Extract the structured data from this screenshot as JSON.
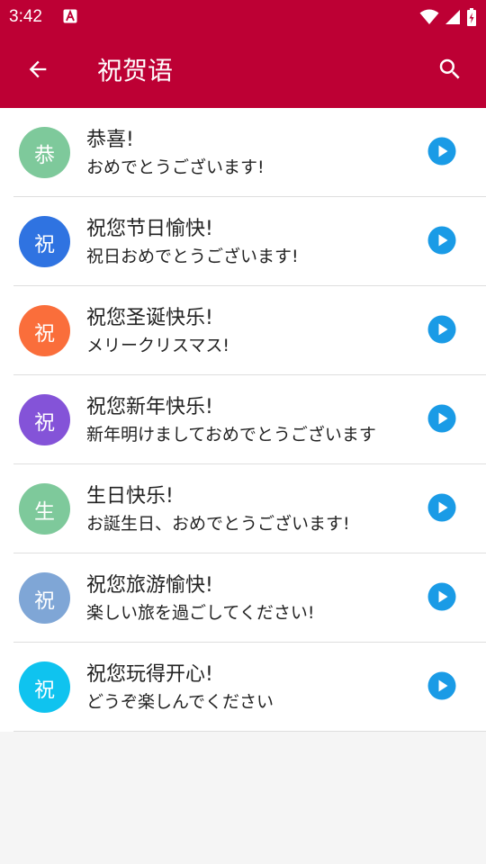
{
  "status_bar": {
    "time": "3:42",
    "notification_icon": "a-notification-icon",
    "icons": [
      "wifi-icon",
      "cell-signal-icon",
      "battery-icon"
    ]
  },
  "app_bar": {
    "title": "祝贺语",
    "back_icon": "arrow-left-icon",
    "search_icon": "search-icon"
  },
  "colors": {
    "primary": "#bd0034",
    "play_button": "#1a9be6",
    "background": "#f5f5f5"
  },
  "items": [
    {
      "avatar": "恭",
      "avatar_color": "#7ec99b",
      "title": "恭喜!",
      "subtitle": "おめでとうございます!"
    },
    {
      "avatar": "祝",
      "avatar_color": "#2f73e1",
      "title": "祝您节日愉快!",
      "subtitle": "祝日おめでとうございます!"
    },
    {
      "avatar": "祝",
      "avatar_color": "#fa6e3b",
      "title": "祝您圣诞快乐!",
      "subtitle": "メリークリスマス!"
    },
    {
      "avatar": "祝",
      "avatar_color": "#8453d8",
      "title": "祝您新年快乐!",
      "subtitle": "新年明けましておめでとうございます"
    },
    {
      "avatar": "生",
      "avatar_color": "#7ec99b",
      "title": "生日快乐!",
      "subtitle": "お誕生日、おめでとうございます!"
    },
    {
      "avatar": "祝",
      "avatar_color": "#7fa6d6",
      "title": "祝您旅游愉快!",
      "subtitle": "楽しい旅を過ごしてください!"
    },
    {
      "avatar": "祝",
      "avatar_color": "#0fc3ef",
      "title": "祝您玩得开心!",
      "subtitle": "どうぞ楽しんでください"
    }
  ]
}
